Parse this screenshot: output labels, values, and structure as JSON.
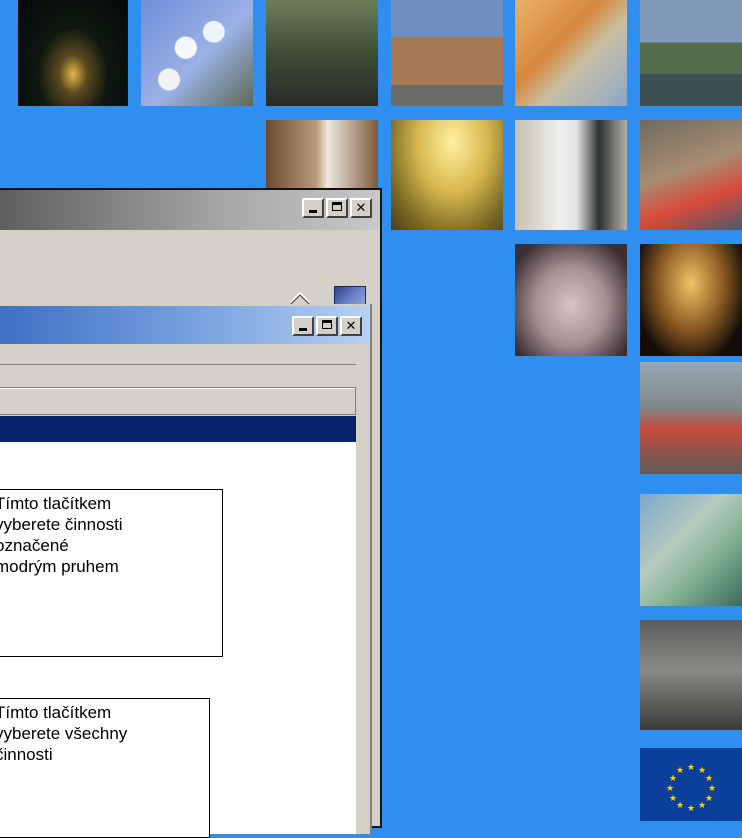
{
  "background_color": "#2f8ff0",
  "photos": [
    {
      "id": "night-castle",
      "icon": "night-castle-photo"
    },
    {
      "id": "blossom",
      "icon": "blossom-photo"
    },
    {
      "id": "stroller",
      "icon": "stroller-photo"
    },
    {
      "id": "building",
      "icon": "building-photo"
    },
    {
      "id": "computer",
      "icon": "computer-users-photo"
    },
    {
      "id": "castle-river",
      "icon": "castle-river-photo"
    },
    {
      "id": "doctor",
      "icon": "doctor-photo"
    },
    {
      "id": "sunset-castle",
      "icon": "sunset-castle-photo"
    },
    {
      "id": "flipchart",
      "icon": "flipchart-photo"
    },
    {
      "id": "tourists",
      "icon": "tourists-photo"
    },
    {
      "id": "coins",
      "icon": "coins-photo"
    },
    {
      "id": "tower",
      "icon": "powder-tower-photo"
    },
    {
      "id": "workers",
      "icon": "construction-workers-photo"
    },
    {
      "id": "dentist",
      "icon": "dentist-photo"
    },
    {
      "id": "wheelchair",
      "icon": "wheelchair-photo"
    },
    {
      "id": "eu-flag",
      "icon": "eu-flag-logo"
    }
  ],
  "window_controls": {
    "minimize": "minimize",
    "maximize": "maximize",
    "close": "close"
  },
  "colors": {
    "titlebar_active": "#3c6fc4",
    "selection": "#0a246a",
    "face": "#d4d0c8"
  },
  "notes": {
    "select_marked": [
      "Tímto tlačítkem",
      "vyberete činnosti",
      "označené",
      "modrým pruhem"
    ],
    "select_all": [
      "Tímto tlačítkem",
      "vyberete všechny",
      "činnosti"
    ]
  }
}
